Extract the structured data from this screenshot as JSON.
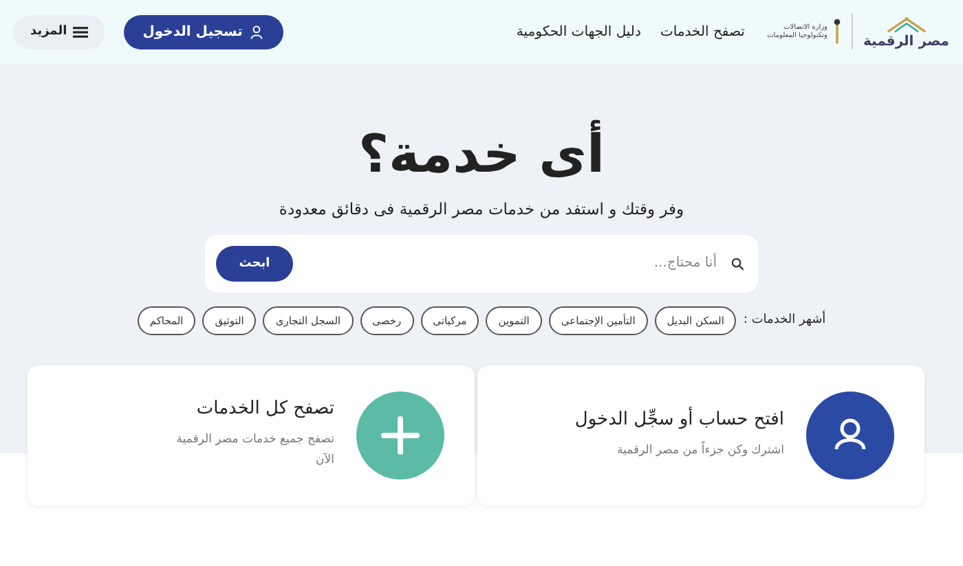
{
  "header": {
    "logo_text": "مصر الرقمية",
    "ministry_text": "وزارة الاتصالات وتكنولوجيا المعلومات",
    "nav": [
      "تصفح الخدمات",
      "دليل الجهات الحكومية"
    ],
    "login_button": "تسجيل الدخول",
    "more_button": "المزيد"
  },
  "hero": {
    "title": "أى خدمة؟",
    "subtitle": "وفر وقتك و استفد من خدمات مصر الرقمية فى دقائق معدودة"
  },
  "search": {
    "placeholder": "أنا محتاج...",
    "button": "ابحث"
  },
  "popular": {
    "label": "أشهر الخدمات :",
    "tags": [
      "السكن البديل",
      "التأمين الإجتماعى",
      "التموين",
      "مركباتى",
      "رخصى",
      "السجل التجارى",
      "التوثيق",
      "المحاكم"
    ]
  },
  "cards": [
    {
      "kind": "account",
      "title": "افتح حساب أو سجِّل الدخول",
      "text": "اشترك وكن جزءاً من مصر الرقمية"
    },
    {
      "kind": "browse",
      "title": "تصفح كل الخدمات",
      "text": "تصفح جميع خدمات مصر الرقمية الآن"
    }
  ]
}
